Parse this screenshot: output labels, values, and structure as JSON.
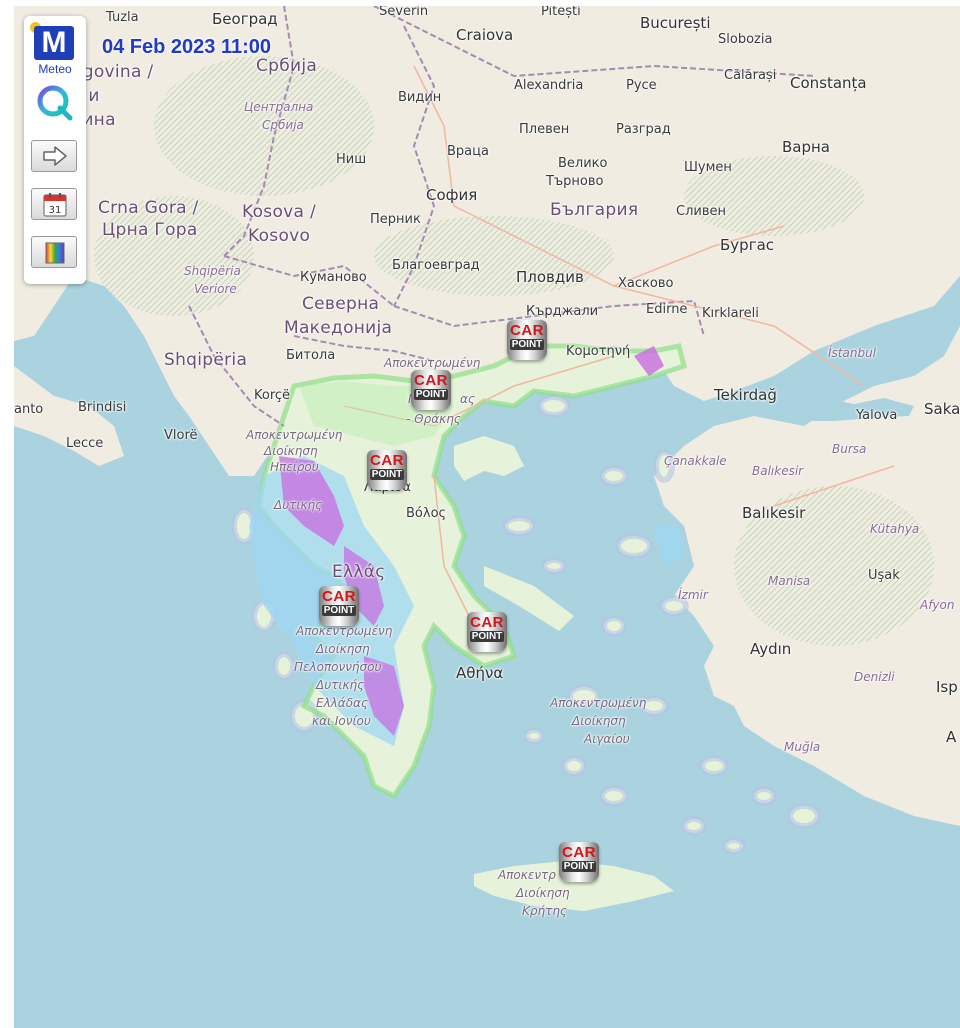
{
  "header": {
    "timestamp": "04 Feb 2023 11:00"
  },
  "logo": {
    "brand": "M",
    "name": "Meteo"
  },
  "controls": [
    {
      "name": "next-button",
      "icon": "arrow-right-icon"
    },
    {
      "name": "calendar-button",
      "icon": "calendar-icon",
      "day": "31"
    },
    {
      "name": "palette-button",
      "icon": "color-palette-icon"
    }
  ],
  "markers": [
    {
      "top": "CAR",
      "bottom": "POINT"
    },
    {
      "top": "CAR",
      "bottom": "POINT"
    },
    {
      "top": "CAR",
      "bottom": "POINT"
    },
    {
      "top": "CAR",
      "bottom": "POINT"
    },
    {
      "top": "CAR",
      "bottom": "POINT"
    },
    {
      "top": "CAR",
      "bottom": "POINT"
    }
  ],
  "labels": {
    "tuzla": "Tuzla",
    "beograd": "Београд",
    "srbija": "Србија",
    "severin": "Severin",
    "pitesti": "Pitești",
    "bucuresti": "București",
    "craiova": "Craiova",
    "slobozia": "Slobozia",
    "herzegovina": "egovina /",
    "bih2": "а и",
    "bih3": "вина",
    "bih4": "o-",
    "centralna": "Централна",
    "srbija2": "Србија",
    "alexandria": "Alexandria",
    "ruse": "Русе",
    "calarasi": "Călărași",
    "constanta": "Constanța",
    "vidin": "Видин",
    "pleven": "Плевен",
    "razgrad": "Разград",
    "varna": "Варна",
    "nis": "Ниш",
    "vratsa": "Враца",
    "veliko": "Велико",
    "tarnovo": "Търново",
    "shumen": "Шумен",
    "crnagora": "Crna Gora /",
    "crnagora2": "Црна Гора",
    "kosova": "Kosova /",
    "kosovo": "Kosovo",
    "sofia": "София",
    "pernik": "Перник",
    "bulgaria": "България",
    "sliven": "Сливен",
    "burgas": "Бургас",
    "shqiperia_veriore": "Shqipëria",
    "veriore": "Veriore",
    "kumanovo": "Куманово",
    "blagoevgrad": "Благоевград",
    "plovdiv": "Пловдив",
    "haskovo": "Хасково",
    "severna": "Северна",
    "makedonija": "Македонија",
    "kardzhali": "Кърджали",
    "edirne": "Edirne",
    "kirklareli": "Kırklareli",
    "shqiperia": "Shqipëria",
    "bitola": "Битола",
    "komotini": "Κομοτηνή",
    "istanbul": "İstanbul",
    "apokentromeni_mth": "Αποκεντρωμένη",
    "mth2": "Μ",
    "mth3": "ας",
    "thrakis": "- Θράκης",
    "tekirdag": "Tekirdağ",
    "yalova": "Yalova",
    "sakarya": "Saka",
    "otranto": "anto",
    "brindisi": "Brindisi",
    "korce": "Korçë",
    "lecce": "Lecce",
    "vlore": "Vlorë",
    "apok_hp": "Αποκεντρωμένη",
    "dioik_hp": "Διοίκηση",
    "hpeirou": "Ηπείρου",
    "ditikis": "Δυτικής",
    "larisa": "Λάρισα",
    "volos": "Βόλος",
    "canakkale": "Çanakkale",
    "balikesir_r": "Balıkesir",
    "bursa": "Bursa",
    "balikesir": "Balıkesir",
    "kutahya": "Kütahya",
    "ellas": "Ελλάς",
    "manisa": "Manisa",
    "usak": "Uşak",
    "izmir": "İzmir",
    "afyon": "Afyon",
    "apok_pel": "Αποκεντρωμένη",
    "dioik_pel": "Διοίκηση",
    "peloponnisou": "Πελοποννήσου",
    "ditikis_ell": "Δυτικής",
    "elladas": "Ελλάδας",
    "kai_ioniou": "και Ιονίου",
    "athina": "Αθήνα",
    "aydin": "Aydın",
    "denizli": "Denizli",
    "isparta": "Isp",
    "apok_aig": "Αποκεντρωμένη",
    "dioik_aig": "Διοίκηση",
    "aigaiou": "Αιγαίου",
    "mugla": "Muğla",
    "a_edge": "A",
    "apok_kr": "Αποκεντρ",
    "dioik_kr": "Διοίκηση",
    "kritis": "Κρήτης"
  }
}
